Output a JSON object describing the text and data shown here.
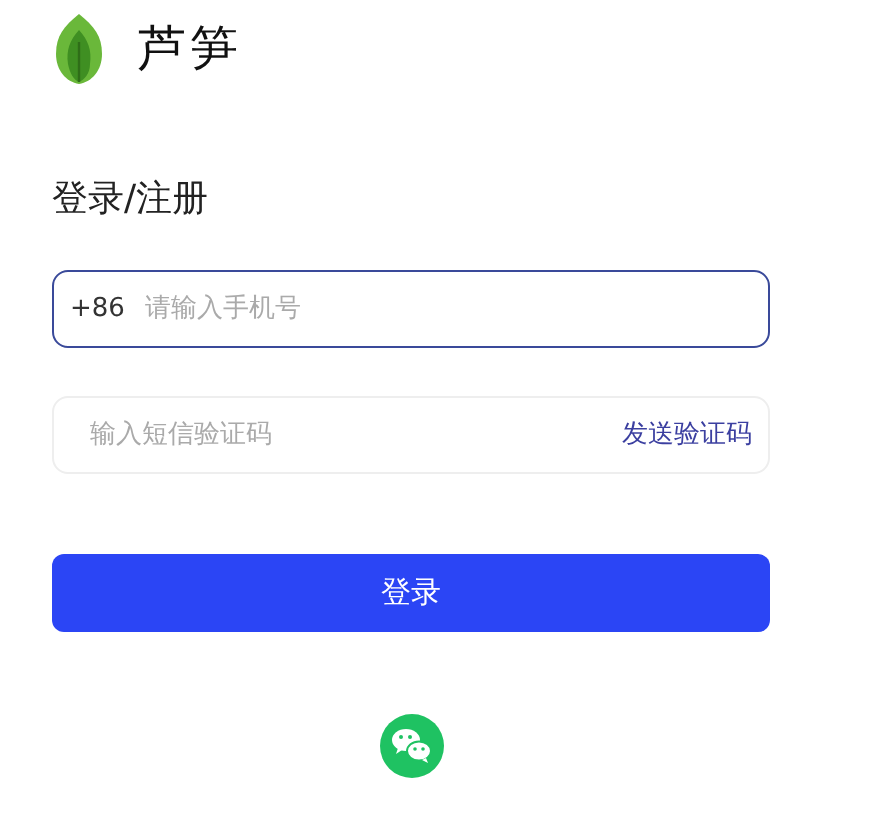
{
  "brand": {
    "name": "芦笋"
  },
  "heading": "登录/注册",
  "phone_field": {
    "prefix": "+86",
    "placeholder": "请输入手机号",
    "focused": true
  },
  "code_field": {
    "placeholder": "输入短信验证码",
    "focused": false,
    "action": "发送验证码"
  },
  "submit_button": "登录",
  "social_login": [
    {
      "kind": "wechat"
    }
  ]
}
